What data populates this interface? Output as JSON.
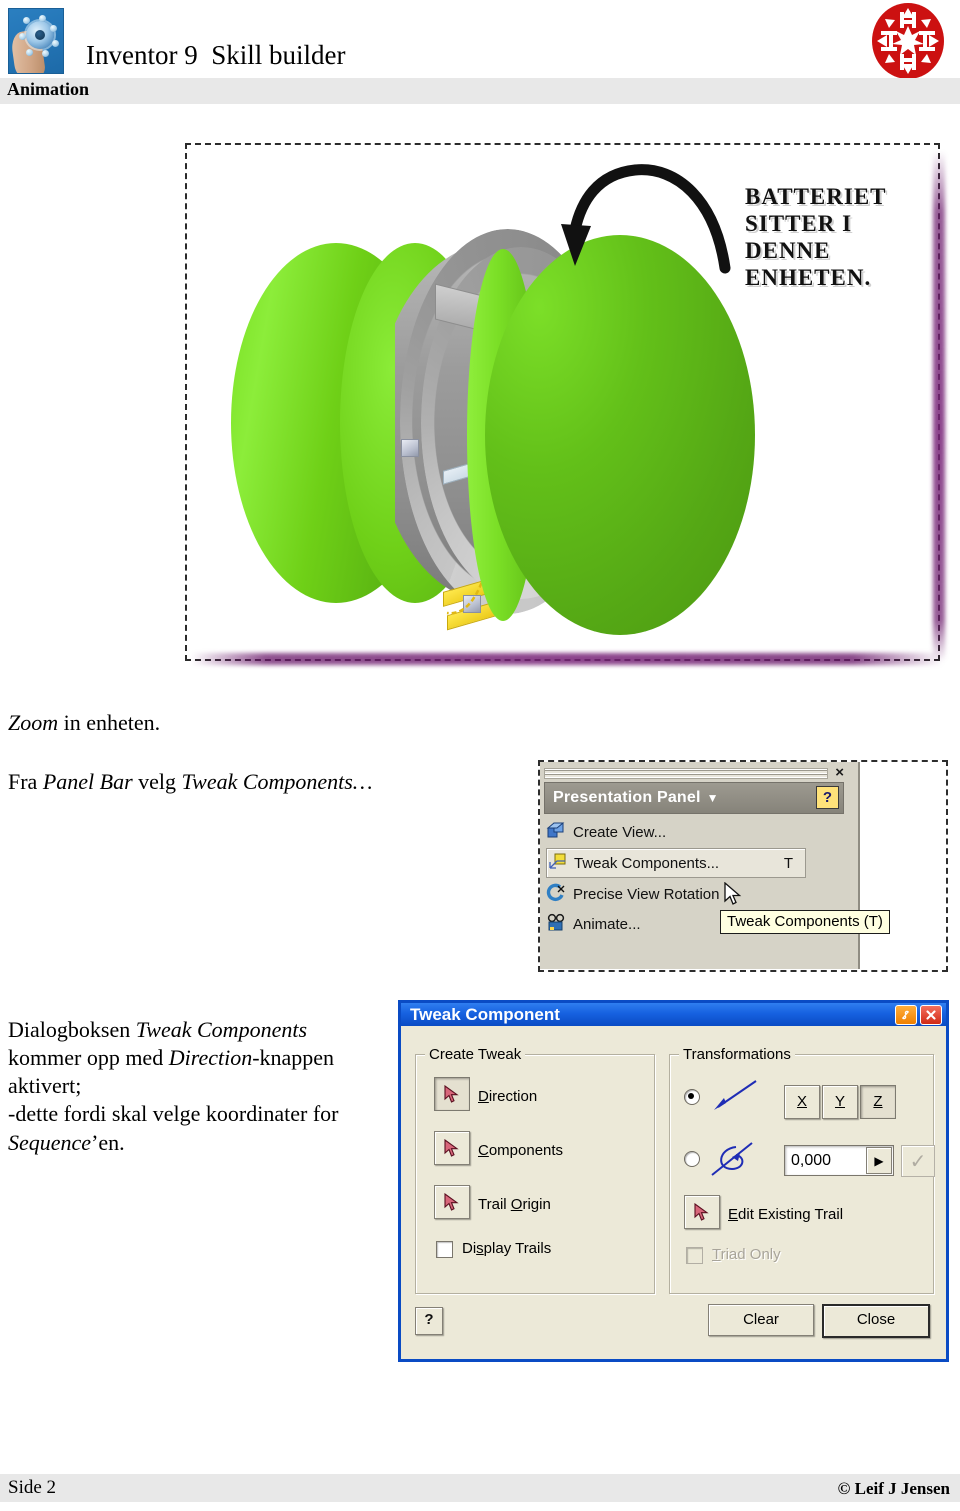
{
  "header": {
    "title": "Inventor 9  Skill builder",
    "subtitle": "Animation",
    "left_logo_name": "hand-holding-assembly-photo",
    "right_logo_name": "red-snowflake-logo",
    "right_logo_color": "#cc1111"
  },
  "figure": {
    "name": "3d-assembly-screenshot",
    "annotation": "BATTERIET\nSITTER I\nDENNE\nENHETEN.",
    "arrow_name": "curved-black-arrow",
    "colors": {
      "green_light": "#7cdf28",
      "green_dark": "#52a515",
      "gray_part": "#a8a8a8",
      "yellow_part": "#e9c715",
      "edge_shadow": "#6a186a"
    }
  },
  "body": {
    "p1_italic": "Zoom",
    "p1_rest": " in enheten.",
    "p2_a": "Fra ",
    "p2_italic1": "Panel Bar",
    "p2_b": " velg ",
    "p2_italic2": "Tweak Components…",
    "p3_a": "Dialogboksen ",
    "p3_italic1": "Tweak Components",
    "p3_b": " kommer opp med ",
    "p3_italic2": "Direction",
    "p3_c": "-knappen aktivert;",
    "p3_d": "-dette fordi skal velge koordinater for ",
    "p3_italic3": "Sequence",
    "p3_e": "’en."
  },
  "panel_bar": {
    "title": "Presentation Panel",
    "caret": "▼",
    "close_glyph": "×",
    "help_glyph": "?",
    "items": [
      {
        "label": "Create View...",
        "key": "",
        "icon": "create-view-icon",
        "selected": false
      },
      {
        "label": "Tweak Components...",
        "key": "T",
        "icon": "tweak-components-icon",
        "selected": true
      },
      {
        "label": "Precise View Rotation",
        "key": "",
        "icon": "precise-view-rotation-icon",
        "selected": false
      },
      {
        "label": "Animate...",
        "key": "",
        "icon": "animate-icon",
        "selected": false
      }
    ],
    "tooltip": "Tweak Components (T)"
  },
  "dialog": {
    "title": "Tweak Component",
    "titlebar_color": "#0a4bc4",
    "pin_button": "roll-up-button",
    "close_button": "✕",
    "create_tweak": {
      "legend": "Create Tweak",
      "buttons": [
        {
          "label": "Direction",
          "mnemonic": "D",
          "pressed": true
        },
        {
          "label": "Components",
          "mnemonic": "C",
          "pressed": false
        },
        {
          "label": "Trail Origin",
          "mnemonic": "O",
          "pressed": false
        }
      ],
      "checkbox": {
        "label": "Display Trails",
        "checked": false,
        "disabled": false
      }
    },
    "transformations": {
      "legend": "Transformations",
      "radio_linear": {
        "name": "linear-move-radio",
        "selected": true
      },
      "radio_rotate": {
        "name": "rotate-radio",
        "selected": false
      },
      "axes": [
        {
          "label": "X",
          "pressed": false
        },
        {
          "label": "Y",
          "pressed": false
        },
        {
          "label": "Z",
          "pressed": true
        }
      ],
      "value": "0,000",
      "spinner_glyph": "▶",
      "apply_glyph": "✓",
      "edit_existing_trail": {
        "label": "Edit Existing Trail",
        "mnemonic": "E"
      },
      "triad_only": {
        "label": "Triad Only",
        "checked": false,
        "disabled": true
      }
    },
    "footer": {
      "help": "?",
      "clear": "Clear",
      "close": "Close"
    }
  },
  "footer": {
    "page": "Side 2",
    "copyright": "© Leif J Jensen"
  }
}
